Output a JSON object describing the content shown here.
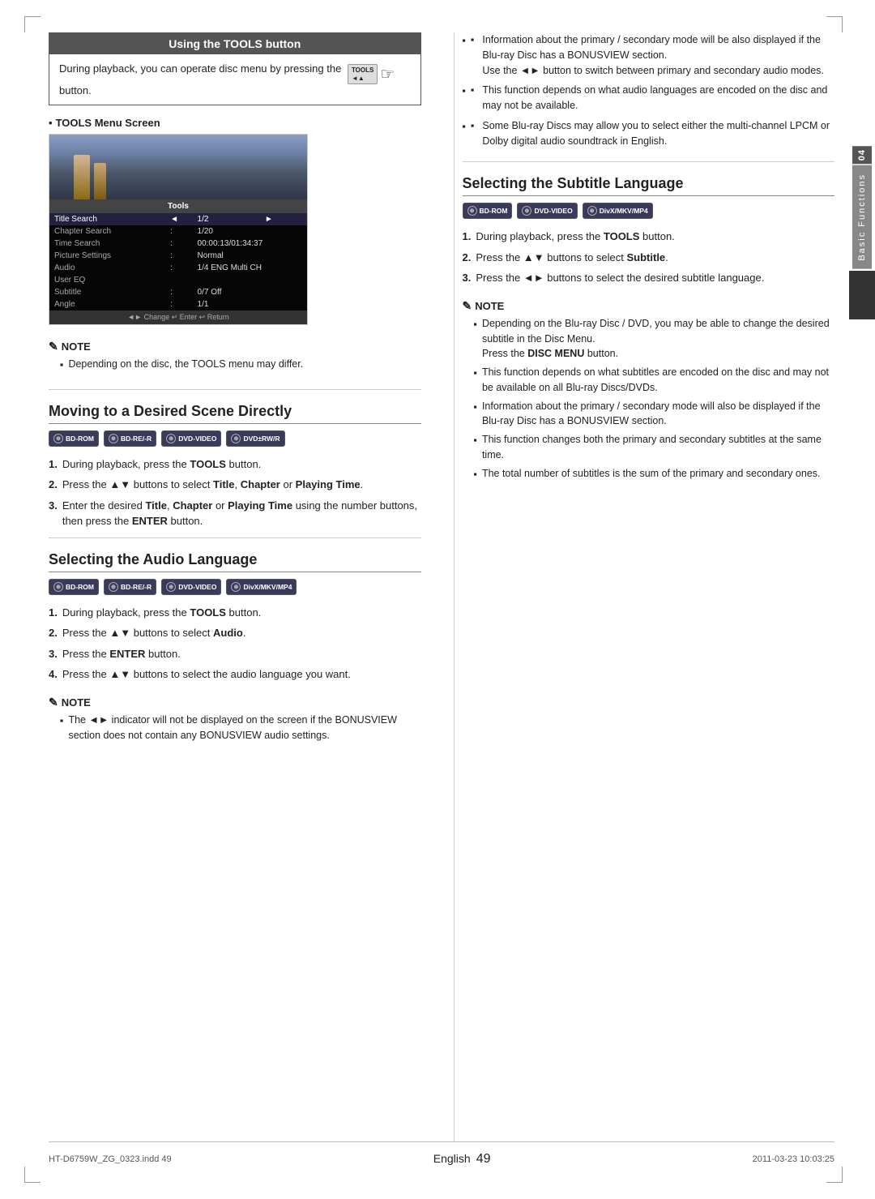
{
  "page": {
    "title": "Using the TOOLS button",
    "side_tab_number": "04",
    "side_tab_text": "Basic Functions",
    "footer_left": "HT-D6759W_ZG_0323.indd   49",
    "footer_right": "2011-03-23   10:03:25",
    "footer_english": "English",
    "footer_page": "49"
  },
  "tools_section": {
    "title": "Using the TOOLS button",
    "intro": "During playback, you can operate disc menu by pressing the",
    "tools_word": "TOOLS",
    "intro_end": "button.",
    "menu_screen_label": "TOOLS Menu Screen",
    "tools_btn_label": "TOOLS",
    "menu_title": "Tools",
    "menu_rows": [
      {
        "label": "Title Search",
        "separator": "◄",
        "value": "1/2",
        "arrow": "►"
      },
      {
        "label": "Chapter Search",
        "separator": ":",
        "value": "1/20",
        "arrow": ""
      },
      {
        "label": "Time Search",
        "separator": ":",
        "value": "00:00:13/01:34:37",
        "arrow": ""
      },
      {
        "label": "Picture Settings",
        "separator": ":",
        "value": "Normal",
        "arrow": ""
      },
      {
        "label": "Audio",
        "separator": ":",
        "value": "1/4 ENG Multi CH",
        "arrow": ""
      },
      {
        "label": "User EQ",
        "separator": "",
        "value": "",
        "arrow": ""
      },
      {
        "label": "Subtitle",
        "separator": ":",
        "value": "0/7 Off",
        "arrow": ""
      },
      {
        "label": "Angle",
        "separator": ":",
        "value": "1/1",
        "arrow": ""
      }
    ],
    "menu_footer": "◄► Change   ↵ Enter   ↩ Return",
    "note_title": "NOTE",
    "note_items": [
      "Depending on the disc, the TOOLS menu may differ."
    ]
  },
  "moving_section": {
    "heading": "Moving to a Desired Scene Directly",
    "badges": [
      "BD-ROM",
      "BD-RE/-R",
      "DVD-VIDEO",
      "DVD±RW/R"
    ],
    "steps": [
      {
        "num": "1.",
        "text_before": "During playback, press the ",
        "bold": "TOOLS",
        "text_after": " button."
      },
      {
        "num": "2.",
        "text_before": "Press the ▲▼ buttons to select ",
        "bold1": "Title",
        "mid": ", ",
        "bold2": "Chapter",
        "mid2": " or ",
        "bold3": "Playing Time",
        "text_after": "."
      },
      {
        "num": "3.",
        "text_before": "Enter the desired ",
        "bold1": "Title",
        "mid": ", ",
        "bold2": "Chapter",
        "mid2": " or ",
        "bold3": "Playing Time",
        "text_after": " using the number buttons, then press the ",
        "bold_end": "ENTER",
        "text_end": " button."
      }
    ]
  },
  "audio_section": {
    "heading": "Selecting the Audio Language",
    "badges": [
      "BD-ROM",
      "BD-RE/-R",
      "DVD-VIDEO",
      "DivX/MKV/MP4"
    ],
    "steps": [
      {
        "num": "1.",
        "text_before": "During playback, press the ",
        "bold": "TOOLS",
        "text_after": " button."
      },
      {
        "num": "2.",
        "text_before": "Press the ▲▼ buttons to select ",
        "bold": "Audio",
        "text_after": "."
      },
      {
        "num": "3.",
        "text_before": "Press the ",
        "bold": "ENTER",
        "text_after": " button."
      },
      {
        "num": "4.",
        "text_before": "Press the ▲▼ buttons to select the audio language you want.",
        "bold": "",
        "text_after": ""
      }
    ],
    "note_title": "NOTE",
    "note_items": [
      "The ◄► indicator will not be displayed on the screen if the BONUSVIEW section does not contain any BONUSVIEW audio settings."
    ]
  },
  "right_col": {
    "bullets": [
      "Information about the primary / secondary mode will be also displayed if the Blu-ray Disc has a BONUSVIEW section. Use the ◄► button to switch between primary and secondary audio modes.",
      "This function depends on what audio languages are encoded on the disc and may not be available.",
      "Some Blu-ray Discs may allow you to select either the multi-channel LPCM or Dolby digital audio soundtrack in English."
    ],
    "subtitle_section": {
      "heading": "Selecting the Subtitle Language",
      "badges": [
        "BD-ROM",
        "DVD-VIDEO",
        "DivX/MKV/MP4"
      ],
      "steps": [
        {
          "num": "1.",
          "text_before": "During playback, press the ",
          "bold": "TOOLS",
          "text_after": " button."
        },
        {
          "num": "2.",
          "text_before": "Press the ▲▼ buttons to select ",
          "bold": "Subtitle",
          "text_after": "."
        },
        {
          "num": "3.",
          "text_before": "Press the ◄► buttons to select the desired subtitle language.",
          "bold": "",
          "text_after": ""
        }
      ],
      "note_title": "NOTE",
      "note_items": [
        "Depending on the Blu-ray Disc / DVD, you may be able to change the desired subtitle in the Disc Menu. Press the DISC MENU button.",
        "This function depends on what subtitles are encoded on the disc and may not be available on all Blu-ray Discs/DVDs.",
        "Information about the primary / secondary mode will also be displayed if the Blu-ray Disc has a BONUSVIEW section.",
        "This function changes both the primary and secondary subtitles at the same time.",
        "The total number of subtitles is the sum of the primary and secondary ones."
      ]
    }
  }
}
